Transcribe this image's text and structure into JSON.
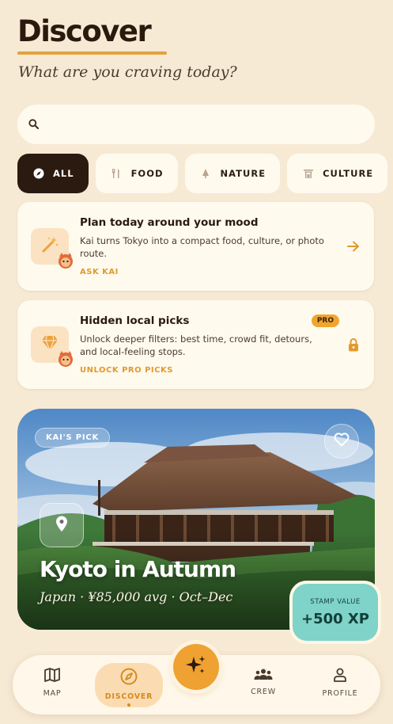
{
  "header": {
    "title": "Discover",
    "subtitle": "What are you craving today?"
  },
  "search": {
    "placeholder": "",
    "value": "",
    "icon": "search-icon"
  },
  "filters": [
    {
      "label": "ALL",
      "icon": "compass-icon",
      "active": true
    },
    {
      "label": "FOOD",
      "icon": "utensils-icon",
      "active": false
    },
    {
      "label": "NATURE",
      "icon": "tree-icon",
      "active": false
    },
    {
      "label": "CULTURE",
      "icon": "temple-icon",
      "active": false
    },
    {
      "label": "",
      "icon": "camera-icon",
      "active": false
    }
  ],
  "cards": [
    {
      "title": "Plan today around your mood",
      "description": "Kai turns Tokyo into a compact food, culture, or photo route.",
      "action": "ASK KAI",
      "icon": "magic-wand-icon",
      "trailing": "arrow-right-icon"
    },
    {
      "title": "Hidden local picks",
      "badge": "PRO",
      "description": "Unlock deeper filters: best time, crowd fit, detours, and local-feeling stops.",
      "action": "UNLOCK PRO PICKS",
      "icon": "gem-icon",
      "trailing": "lock-icon"
    }
  ],
  "featured": {
    "tag": "KAI'S PICK",
    "title": "Kyoto in Autumn",
    "subtitle": "Japan · ¥85,000 avg · Oct–Dec",
    "stamp_label": "STAMP VALUE",
    "stamp_value": "+500 XP"
  },
  "tabbar": {
    "items": [
      {
        "label": "MAP",
        "icon": "map-icon",
        "active": false
      },
      {
        "label": "DISCOVER",
        "icon": "compass-icon",
        "active": true
      },
      {
        "label": "CREW",
        "icon": "group-icon",
        "active": false
      },
      {
        "label": "PROFILE",
        "icon": "person-icon",
        "active": false
      }
    ],
    "center_icon": "sparkle-icon"
  },
  "colors": {
    "background": "#f7ead5",
    "accent": "#efa131",
    "dark": "#2b1a10",
    "stamp": "#7fd3c8"
  }
}
